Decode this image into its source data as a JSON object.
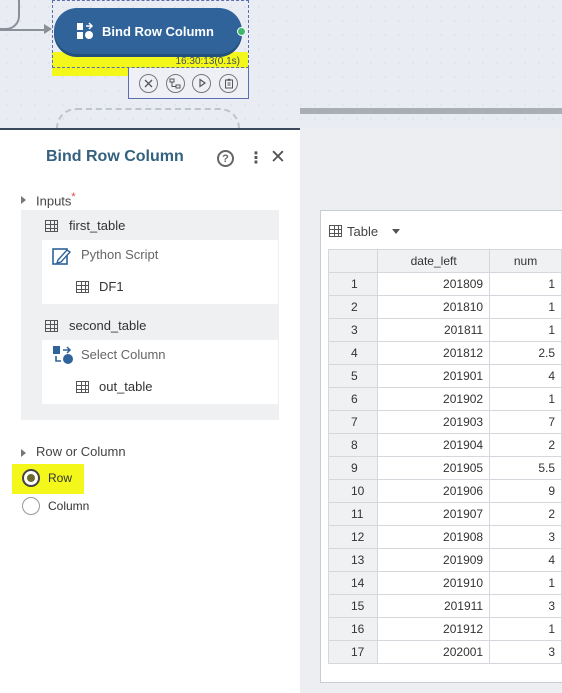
{
  "node": {
    "title": "Bind Row Column",
    "time": "16:30:13(0.1s)",
    "actions": [
      "stop-icon",
      "branch-icon",
      "play-icon",
      "clipboard-icon"
    ]
  },
  "panel": {
    "title": "Bind Row Column",
    "help": "?",
    "more": "⋮",
    "close": "✕",
    "inputs_label": "Inputs",
    "required_mark": "*",
    "inputs": [
      {
        "name": "first_table",
        "source_type": "Python Script",
        "source_output": "DF1"
      },
      {
        "name": "second_table",
        "source_type": "Select Column",
        "source_output": "out_table"
      }
    ],
    "row_or_column_label": "Row or Column",
    "options": [
      {
        "label": "Row",
        "checked": true
      },
      {
        "label": "Column",
        "checked": false
      }
    ]
  },
  "grid": {
    "view_label": "Table",
    "columns": [
      "",
      "date_left",
      "num"
    ],
    "rows": [
      [
        "1",
        "201809",
        "1"
      ],
      [
        "2",
        "201810",
        "1"
      ],
      [
        "3",
        "201811",
        "1"
      ],
      [
        "4",
        "201812",
        "2.5"
      ],
      [
        "5",
        "201901",
        "4"
      ],
      [
        "6",
        "201902",
        "1"
      ],
      [
        "7",
        "201903",
        "7"
      ],
      [
        "8",
        "201904",
        "2"
      ],
      [
        "9",
        "201905",
        "5.5"
      ],
      [
        "10",
        "201906",
        "9"
      ],
      [
        "11",
        "201907",
        "2"
      ],
      [
        "12",
        "201908",
        "3"
      ],
      [
        "13",
        "201909",
        "4"
      ],
      [
        "14",
        "201910",
        "1"
      ],
      [
        "15",
        "201911",
        "3"
      ],
      [
        "16",
        "201912",
        "1"
      ],
      [
        "17",
        "202001",
        "3"
      ]
    ]
  },
  "colors": {
    "node_fill": "#2f6399",
    "highlight": "#f4f71a",
    "port": "#3cb96a",
    "title": "#34617f"
  }
}
